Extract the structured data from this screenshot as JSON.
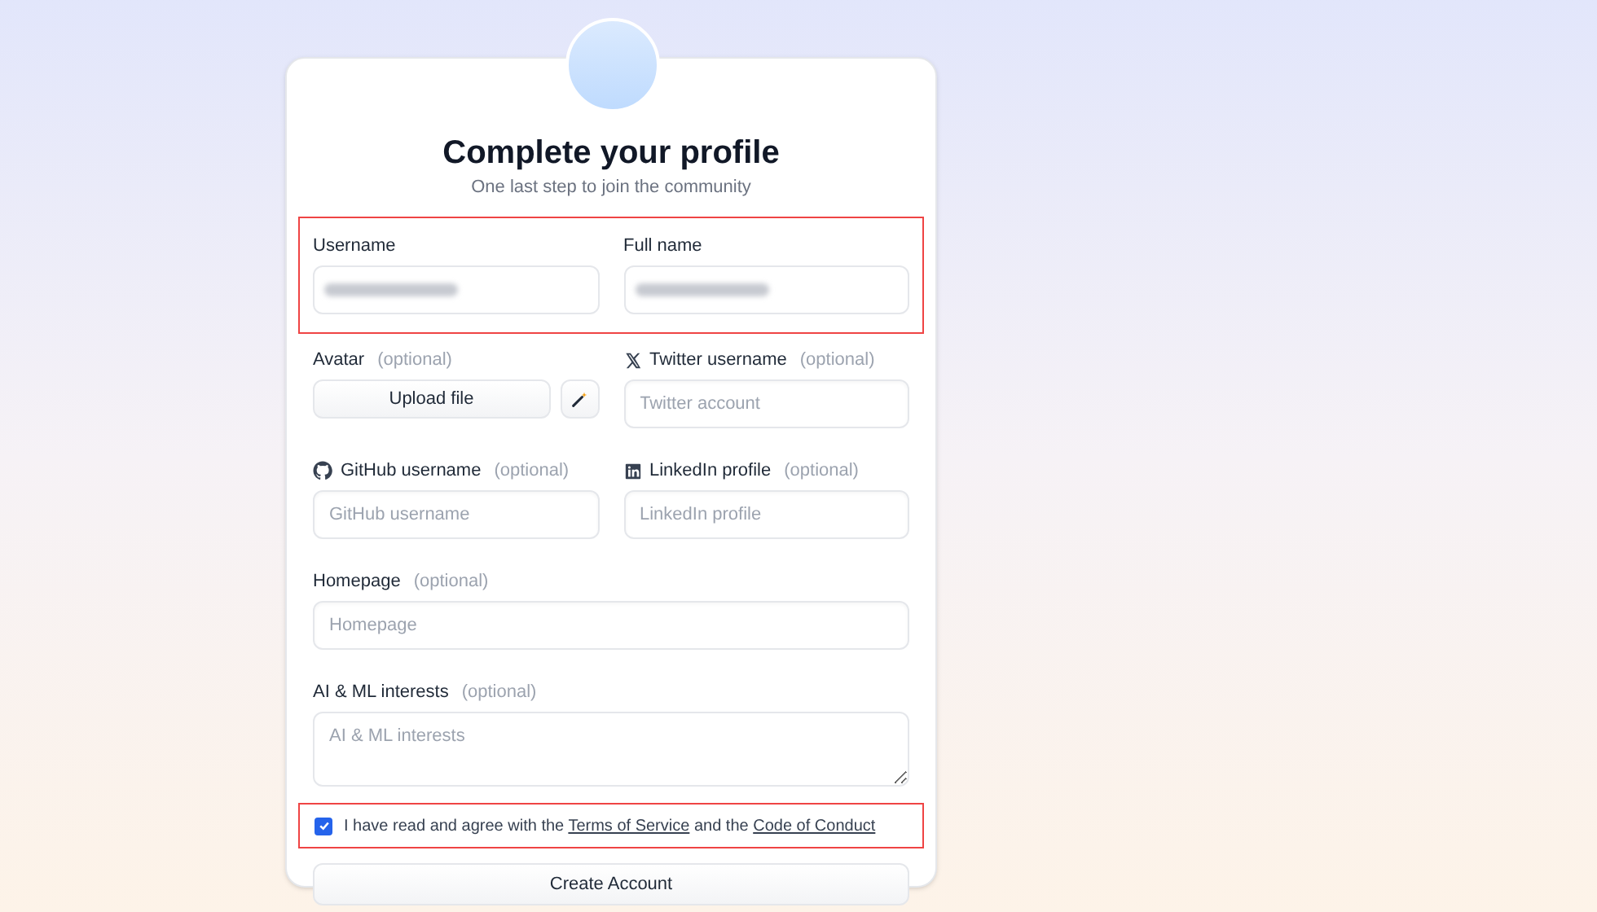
{
  "title": "Complete your profile",
  "subtitle": "One last step to join the community",
  "required_fields": {
    "highlighted": true,
    "fields": [
      {
        "label": "Username",
        "redacted": true
      },
      {
        "label": "Full name",
        "redacted": true
      }
    ]
  },
  "optional_fields": [
    {
      "kind": "upload",
      "label": "Avatar",
      "hint": "(optional)",
      "button": "Upload file",
      "wide": false
    },
    {
      "kind": "input",
      "label": "Twitter username",
      "hint": "(optional)",
      "placeholder": "Twitter account",
      "wide": false
    },
    {
      "kind": "input",
      "label": "GitHub username",
      "hint": "(optional)",
      "placeholder": "GitHub username",
      "wide": false
    },
    {
      "kind": "input",
      "label": "LinkedIn profile",
      "hint": "(optional)",
      "placeholder": "LinkedIn profile",
      "wide": false
    },
    {
      "kind": "input",
      "label": "Homepage",
      "hint": "(optional)",
      "placeholder": "Homepage",
      "wide": true
    },
    {
      "kind": "textarea",
      "label": "AI & ML interests",
      "hint": "(optional)",
      "placeholder": "AI & ML interests",
      "wide": true
    }
  ],
  "agreement": {
    "checked": true,
    "highlighted": true,
    "text_1": "I have read and agree with the",
    "link_1": "Terms of Service",
    "text_2": "and the",
    "link_2": "Code of Conduct"
  },
  "submit": "Create Account"
}
